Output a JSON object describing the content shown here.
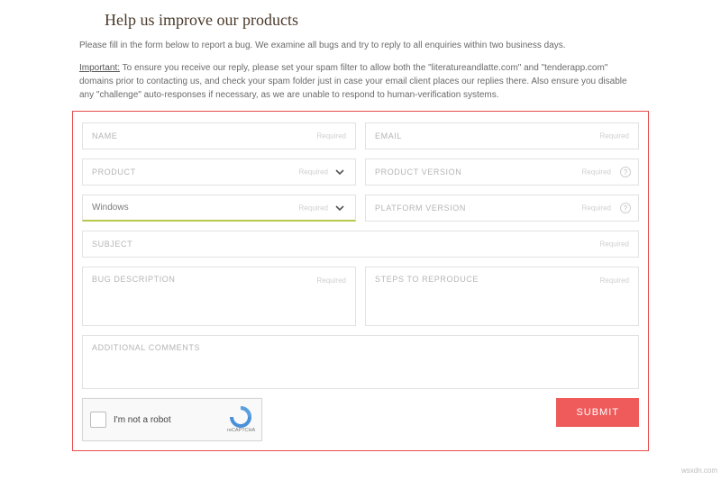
{
  "heading": "Help us improve our products",
  "intro1": "Please fill in the form below to report a bug. We examine all bugs and try to reply to all enquiries within two business days.",
  "important_label": "Important:",
  "intro2": " To ensure you receive our reply, please set your spam filter to allow both the \"literatureandlatte.com\" and \"tenderapp.com\" domains prior to contacting us, and check your spam folder just in case your email client places our replies there. Also ensure you disable any \"challenge\" auto-responses if necessary, as we are unable to respond to human-verification systems.",
  "required_label": "Required",
  "fields": {
    "name": "NAME",
    "email": "EMAIL",
    "product": "PRODUCT",
    "product_version": "PRODUCT VERSION",
    "platform_value": "Windows",
    "platform_version": "PLATFORM VERSION",
    "subject": "SUBJECT",
    "bug_description": "BUG DESCRIPTION",
    "steps": "STEPS TO REPRODUCE",
    "additional": "ADDITIONAL COMMENTS"
  },
  "help_icon": "?",
  "captcha": {
    "label": "I'm not a robot",
    "brand": "reCAPTCHA"
  },
  "submit": "SUBMIT",
  "watermark": "wsxdn.com"
}
